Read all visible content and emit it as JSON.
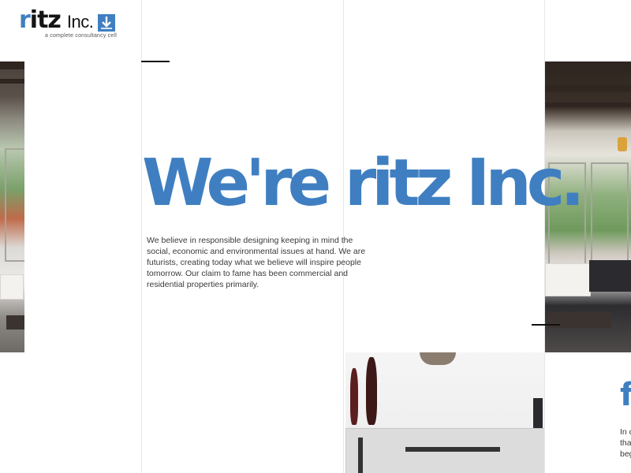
{
  "logo": {
    "name_r": "r",
    "name_rest": "itz",
    "name_suffix": "Inc.",
    "tagline": "a complete consultancy cell",
    "icon": "down-arrow-box-icon"
  },
  "hero": {
    "headline": "We're ritz Inc.",
    "intro": "We believe in responsible designing keeping in mind the social, economic and environmental issues at hand.  We are futurists, creating today what we believe will inspire people tomorrow. Our claim to fame has been commercial and residential properties primarily."
  },
  "teaser": {
    "heading_fragment": "f",
    "text_lines": [
      "In c",
      "tha",
      "beg"
    ]
  },
  "colors": {
    "accent": "#3f7fc1",
    "text": "#3a3a3a"
  }
}
